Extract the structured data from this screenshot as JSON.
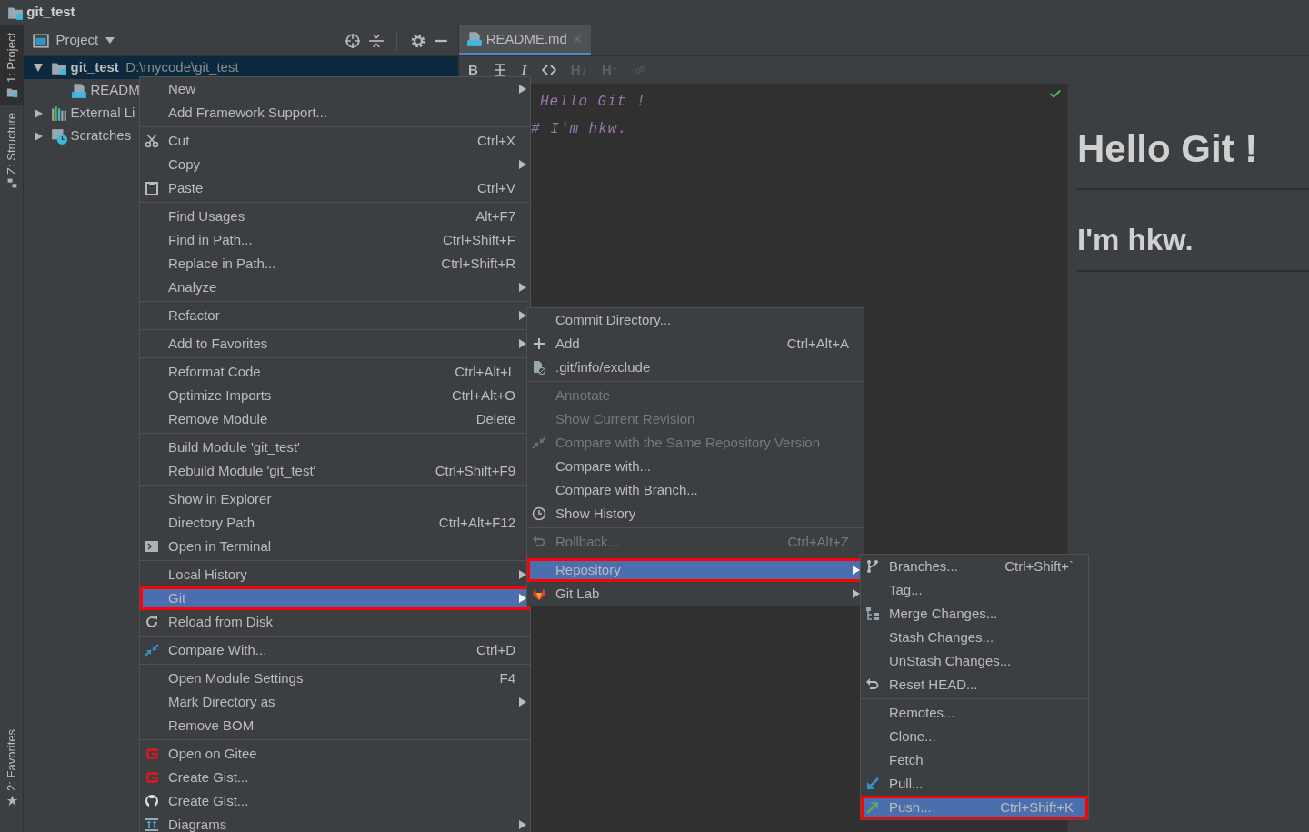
{
  "window": {
    "title": "git_test"
  },
  "tool_stripe": [
    {
      "kind": "project",
      "label": "1: Project",
      "selected": true
    },
    {
      "kind": "structure",
      "label": "Z: Structure",
      "selected": false
    },
    {
      "kind": "favorites",
      "label": "2: Favorites",
      "selected": false
    }
  ],
  "project_panel": {
    "title": "Project"
  },
  "tree": [
    {
      "kind": "module",
      "label": "git_test",
      "path": "D:\\mycode\\git_test",
      "expanded": true,
      "selected": true,
      "children": [
        {
          "kind": "markdown",
          "label": "READM",
          "selected": false
        }
      ]
    },
    {
      "kind": "library",
      "label": "External Li",
      "expanded": false,
      "selected": false
    },
    {
      "kind": "scratches",
      "label": "Scratches",
      "expanded": false,
      "selected": false
    }
  ],
  "editor": {
    "tab": {
      "label": "README.md",
      "selected": true
    },
    "toolbar": [
      {
        "kind": "text",
        "label": "B",
        "disabled": false
      },
      {
        "kind": "strike",
        "disabled": false
      },
      {
        "kind": "italic",
        "label": "I",
        "disabled": false
      },
      {
        "kind": "code",
        "disabled": false
      },
      {
        "kind": "text",
        "label": "H↓",
        "disabled": true
      },
      {
        "kind": "text",
        "label": "H↑",
        "disabled": true
      },
      {
        "kind": "link",
        "disabled": true
      }
    ],
    "lines": [
      "Hello Git !",
      "# I'm hkw."
    ],
    "preview": [
      {
        "kind": "h1",
        "text": "Hello Git !"
      },
      {
        "kind": "h2",
        "text": "I'm hkw."
      }
    ]
  },
  "menus": [
    {
      "items": [
        {
          "kind": "item",
          "label": "New",
          "submenu": true,
          "selected": false
        },
        {
          "kind": "item",
          "label": "Add Framework Support...",
          "submenu": false,
          "selected": false
        },
        {
          "kind": "separator"
        },
        {
          "kind": "cut",
          "label": "Cut",
          "shortcut": "Ctrl+X",
          "submenu": false,
          "selected": false
        },
        {
          "kind": "item",
          "label": "Copy",
          "submenu": true,
          "selected": false
        },
        {
          "kind": "paste",
          "label": "Paste",
          "shortcut": "Ctrl+V",
          "submenu": false,
          "selected": false
        },
        {
          "kind": "separator"
        },
        {
          "kind": "item",
          "label": "Find Usages",
          "shortcut": "Alt+F7",
          "submenu": false,
          "selected": false
        },
        {
          "kind": "item",
          "label": "Find in Path...",
          "shortcut": "Ctrl+Shift+F",
          "submenu": false,
          "selected": false
        },
        {
          "kind": "item",
          "label": "Replace in Path...",
          "shortcut": "Ctrl+Shift+R",
          "submenu": false,
          "selected": false
        },
        {
          "kind": "item",
          "label": "Analyze",
          "submenu": true,
          "selected": false
        },
        {
          "kind": "separator"
        },
        {
          "kind": "item",
          "label": "Refactor",
          "submenu": true,
          "selected": false
        },
        {
          "kind": "separator"
        },
        {
          "kind": "item",
          "label": "Add to Favorites",
          "submenu": true,
          "selected": false
        },
        {
          "kind": "separator"
        },
        {
          "kind": "item",
          "label": "Reformat Code",
          "shortcut": "Ctrl+Alt+L",
          "submenu": false,
          "selected": false
        },
        {
          "kind": "item",
          "label": "Optimize Imports",
          "shortcut": "Ctrl+Alt+O",
          "submenu": false,
          "selected": false
        },
        {
          "kind": "item",
          "label": "Remove Module",
          "shortcut": "Delete",
          "submenu": false,
          "selected": false
        },
        {
          "kind": "separator"
        },
        {
          "kind": "item",
          "label": "Build Module 'git_test'",
          "submenu": false,
          "selected": false
        },
        {
          "kind": "item",
          "label": "Rebuild Module 'git_test'",
          "shortcut": "Ctrl+Shift+F9",
          "submenu": false,
          "selected": false
        },
        {
          "kind": "separator"
        },
        {
          "kind": "item",
          "label": "Show in Explorer",
          "submenu": false,
          "selected": false
        },
        {
          "kind": "item",
          "label": "Directory Path",
          "shortcut": "Ctrl+Alt+F12",
          "submenu": false,
          "selected": false
        },
        {
          "kind": "terminal",
          "label": "Open in Terminal",
          "submenu": false,
          "selected": false
        },
        {
          "kind": "separator"
        },
        {
          "kind": "item",
          "label": "Local History",
          "submenu": true,
          "selected": false
        },
        {
          "kind": "item",
          "label": "Git",
          "submenu": true,
          "selected": true
        },
        {
          "kind": "reload",
          "label": "Reload from Disk",
          "submenu": false,
          "selected": false
        },
        {
          "kind": "separator"
        },
        {
          "kind": "compare",
          "label": "Compare With...",
          "shortcut": "Ctrl+D",
          "submenu": false,
          "selected": false
        },
        {
          "kind": "separator"
        },
        {
          "kind": "item",
          "label": "Open Module Settings",
          "shortcut": "F4",
          "submenu": false,
          "selected": false
        },
        {
          "kind": "item",
          "label": "Mark Directory as",
          "submenu": true,
          "selected": false
        },
        {
          "kind": "item",
          "label": "Remove BOM",
          "submenu": false,
          "selected": false
        },
        {
          "kind": "separator"
        },
        {
          "kind": "gitee",
          "label": "Open on Gitee",
          "submenu": false,
          "selected": false
        },
        {
          "kind": "gitee",
          "label": "Create Gist...",
          "submenu": false,
          "selected": false
        },
        {
          "kind": "github",
          "label": "Create Gist...",
          "submenu": false,
          "selected": false
        },
        {
          "kind": "diagrams",
          "label": "Diagrams",
          "submenu": true,
          "selected": false
        }
      ]
    },
    {
      "items": [
        {
          "kind": "item",
          "label": "Commit Directory...",
          "submenu": false,
          "disabled": false,
          "selected": false
        },
        {
          "kind": "add",
          "label": "Add",
          "shortcut": "Ctrl+Alt+A",
          "submenu": false,
          "disabled": false,
          "selected": false
        },
        {
          "kind": "exclude",
          "label": ".git/info/exclude",
          "submenu": false,
          "disabled": false,
          "selected": false
        },
        {
          "kind": "separator"
        },
        {
          "kind": "item",
          "label": "Annotate",
          "submenu": false,
          "disabled": true,
          "selected": false
        },
        {
          "kind": "item",
          "label": "Show Current Revision",
          "submenu": false,
          "disabled": true,
          "selected": false
        },
        {
          "kind": "compare",
          "label": "Compare with the Same Repository Version",
          "submenu": false,
          "disabled": true,
          "selected": false
        },
        {
          "kind": "item",
          "label": "Compare with...",
          "submenu": false,
          "disabled": false,
          "selected": false
        },
        {
          "kind": "item",
          "label": "Compare with Branch...",
          "submenu": false,
          "disabled": false,
          "selected": false
        },
        {
          "kind": "history",
          "label": "Show History",
          "submenu": false,
          "disabled": false,
          "selected": false
        },
        {
          "kind": "separator"
        },
        {
          "kind": "rollback",
          "label": "Rollback...",
          "shortcut": "Ctrl+Alt+Z",
          "submenu": false,
          "disabled": true,
          "selected": false
        },
        {
          "kind": "separator"
        },
        {
          "kind": "item",
          "label": "Repository",
          "submenu": true,
          "disabled": false,
          "selected": true
        },
        {
          "kind": "gitlab",
          "label": "Git Lab",
          "submenu": true,
          "disabled": false,
          "selected": false
        }
      ]
    },
    {
      "items": [
        {
          "kind": "branches",
          "label": "Branches...",
          "shortcut": "Ctrl+Shift+`",
          "submenu": false,
          "selected": false
        },
        {
          "kind": "item",
          "label": "Tag...",
          "submenu": false,
          "selected": false
        },
        {
          "kind": "merge",
          "label": "Merge Changes...",
          "submenu": false,
          "selected": false
        },
        {
          "kind": "item",
          "label": "Stash Changes...",
          "submenu": false,
          "selected": false
        },
        {
          "kind": "item",
          "label": "UnStash Changes...",
          "submenu": false,
          "selected": false
        },
        {
          "kind": "reset",
          "label": "Reset HEAD...",
          "submenu": false,
          "selected": false
        },
        {
          "kind": "separator"
        },
        {
          "kind": "item",
          "label": "Remotes...",
          "submenu": false,
          "selected": false
        },
        {
          "kind": "item",
          "label": "Clone...",
          "submenu": false,
          "selected": false
        },
        {
          "kind": "item",
          "label": "Fetch",
          "submenu": false,
          "selected": false
        },
        {
          "kind": "pull",
          "label": "Pull...",
          "submenu": false,
          "selected": false
        },
        {
          "kind": "push",
          "label": "Push...",
          "shortcut": "Ctrl+Shift+K",
          "submenu": false,
          "selected": true
        }
      ]
    }
  ]
}
